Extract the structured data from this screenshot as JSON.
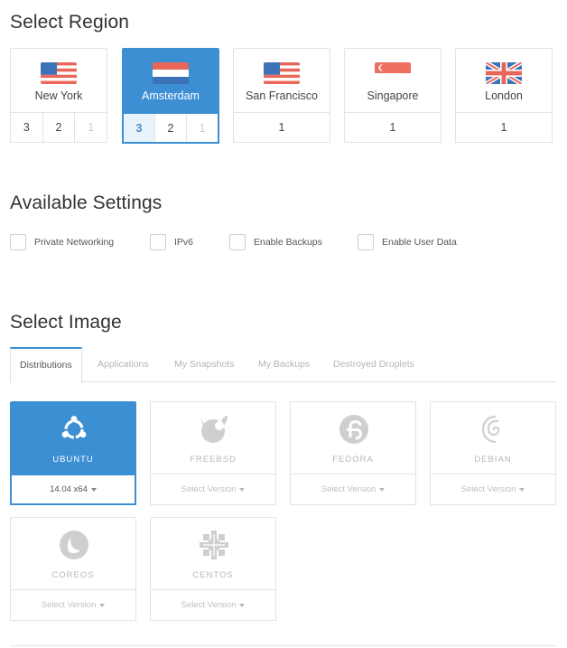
{
  "region_section": {
    "title": "Select Region",
    "regions": [
      {
        "city": "New York",
        "versions": [
          "3",
          "2",
          "1"
        ],
        "selected": false,
        "flag": "us-flag-icon"
      },
      {
        "city": "Amsterdam",
        "versions": [
          "3",
          "2",
          "1"
        ],
        "selected": true,
        "flag": "nl-flag-icon"
      },
      {
        "city": "San Francisco",
        "versions": [
          "1"
        ],
        "selected": false,
        "flag": "us-flag-icon"
      },
      {
        "city": "Singapore",
        "versions": [
          "1"
        ],
        "selected": false,
        "flag": "sg-flag-icon"
      },
      {
        "city": "London",
        "versions": [
          "1"
        ],
        "selected": false,
        "flag": "uk-flag-icon"
      }
    ]
  },
  "settings_section": {
    "title": "Available Settings",
    "options": [
      {
        "label": "Private Networking",
        "checked": false
      },
      {
        "label": "IPv6",
        "checked": false
      },
      {
        "label": "Enable Backups",
        "checked": false
      },
      {
        "label": "Enable User Data",
        "checked": false
      }
    ]
  },
  "image_section": {
    "title": "Select Image",
    "tabs": [
      "Distributions",
      "Applications",
      "My Snapshots",
      "My Backups",
      "Destroyed Droplets"
    ],
    "active_tab": "Distributions",
    "images": [
      {
        "name": "UBUNTU",
        "version": "14.04 x64",
        "selected": true,
        "icon": "ubuntu-logo-icon"
      },
      {
        "name": "FREEBSD",
        "version": "Select Version",
        "selected": false,
        "icon": "freebsd-logo-icon"
      },
      {
        "name": "FEDORA",
        "version": "Select Version",
        "selected": false,
        "icon": "fedora-logo-icon"
      },
      {
        "name": "DEBIAN",
        "version": "Select Version",
        "selected": false,
        "icon": "debian-logo-icon"
      },
      {
        "name": "COREOS",
        "version": "Select Version",
        "selected": false,
        "icon": "coreos-logo-icon"
      },
      {
        "name": "CENTOS",
        "version": "Select Version",
        "selected": false,
        "icon": "centos-logo-icon"
      }
    ]
  },
  "colors": {
    "accent": "#3d8fd4",
    "border": "#e3e3e3",
    "muted_text": "#b8b8b8"
  }
}
